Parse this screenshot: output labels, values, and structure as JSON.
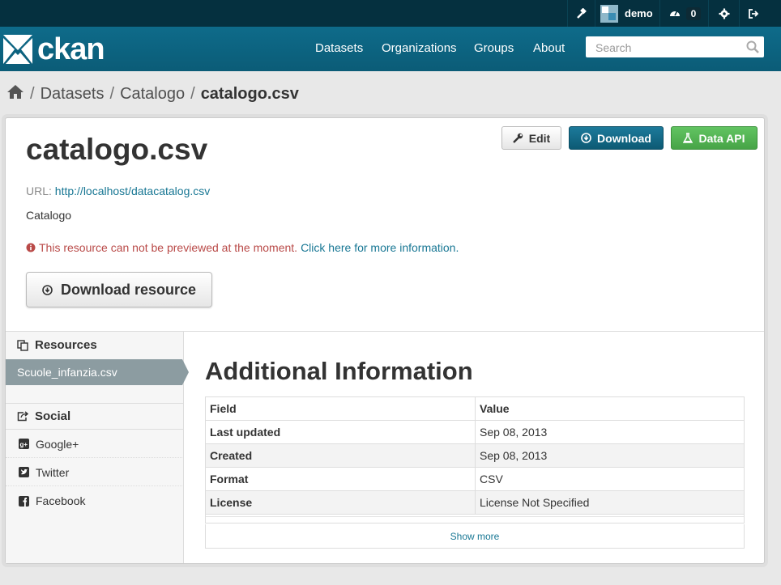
{
  "account": {
    "username": "demo",
    "notifications": "0"
  },
  "brand": {
    "name": "ckan"
  },
  "nav": {
    "datasets": "Datasets",
    "organizations": "Organizations",
    "groups": "Groups",
    "about": "About"
  },
  "search": {
    "placeholder": "Search"
  },
  "breadcrumb": {
    "sep": "/",
    "items": [
      "Datasets",
      "Catalogo",
      "catalogo.csv"
    ]
  },
  "resource": {
    "title": "catalogo.csv",
    "url_label": "URL:",
    "url": "http://localhost/datacatalog.csv",
    "description": "Catalogo",
    "preview_warning": "This resource can not be previewed at the moment.",
    "preview_link": "Click here for more information.",
    "download_resource_label": "Download resource"
  },
  "actions": {
    "edit": "Edit",
    "download": "Download",
    "data_api": "Data API"
  },
  "sidebar": {
    "resources_heading": "Resources",
    "active_resource": "Scuole_infanzia.csv",
    "social_heading": "Social",
    "social": [
      "Google+",
      "Twitter",
      "Facebook"
    ]
  },
  "additional_info": {
    "title": "Additional Information",
    "columns": [
      "Field",
      "Value"
    ],
    "rows": [
      {
        "field": "Last updated",
        "value": "Sep 08, 2013"
      },
      {
        "field": "Created",
        "value": "Sep 08, 2013"
      },
      {
        "field": "Format",
        "value": "CSV"
      },
      {
        "field": "License",
        "value": "License Not Specified"
      }
    ],
    "show_more": "Show more"
  },
  "colors": {
    "account_bar": "#05303f",
    "masthead": "#0d6684",
    "link": "#187794",
    "warning": "#b94a48",
    "primary_button": "#0d5a74",
    "api_button": "#51b351"
  }
}
